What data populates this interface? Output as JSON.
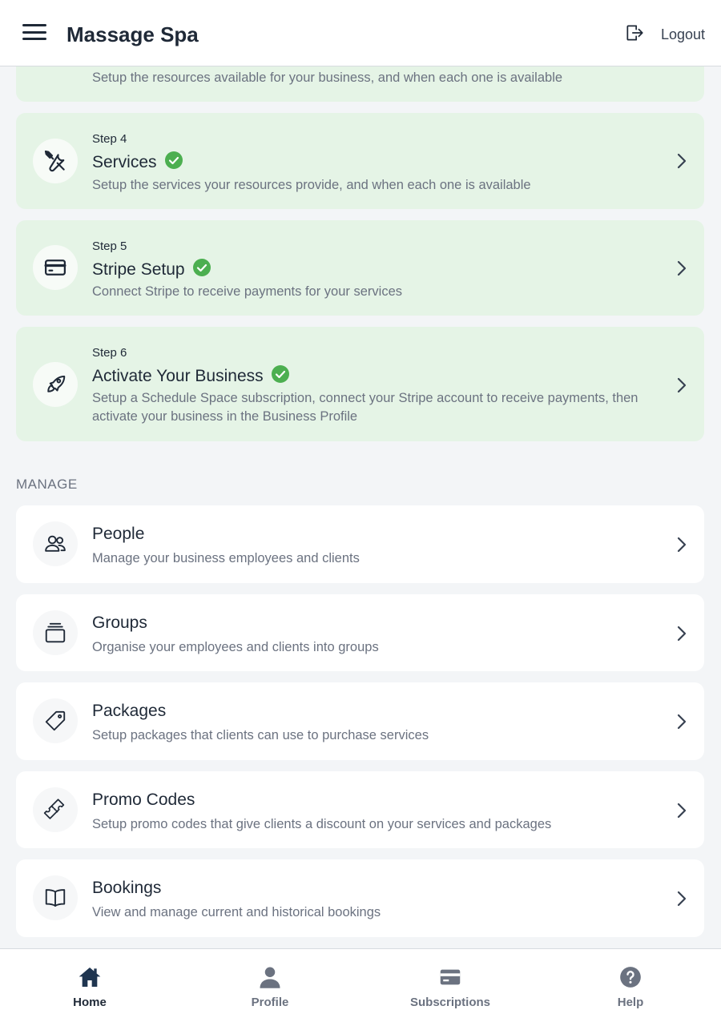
{
  "header": {
    "title": "Massage Spa",
    "logout_label": "Logout"
  },
  "steps": [
    {
      "step": "",
      "title": "",
      "desc": "Setup the resources available for your business, and when each one is available",
      "icon": "resources-icon"
    },
    {
      "step": "Step 4",
      "title": "Services",
      "desc": "Setup the services your resources provide, and when each one is available",
      "icon": "tools-icon",
      "complete": true
    },
    {
      "step": "Step 5",
      "title": "Stripe Setup",
      "desc": "Connect Stripe to receive payments for your services",
      "icon": "credit-card-icon",
      "complete": true
    },
    {
      "step": "Step 6",
      "title": "Activate Your Business",
      "desc": "Setup a Schedule Space subscription, connect your Stripe account to receive payments, then activate your business in the Business Profile",
      "icon": "rocket-icon",
      "complete": true
    }
  ],
  "manage": {
    "section_label": "MANAGE",
    "items": [
      {
        "title": "People",
        "desc": "Manage your business employees and clients",
        "icon": "people-icon"
      },
      {
        "title": "Groups",
        "desc": "Organise your employees and clients into groups",
        "icon": "groups-icon"
      },
      {
        "title": "Packages",
        "desc": "Setup packages that clients can use to purchase services",
        "icon": "tag-icon"
      },
      {
        "title": "Promo Codes",
        "desc": "Setup promo codes that give clients a discount on your services and packages",
        "icon": "ticket-icon"
      },
      {
        "title": "Bookings",
        "desc": "View and manage current and historical bookings",
        "icon": "book-icon"
      }
    ]
  },
  "bottom_nav": [
    {
      "label": "Home",
      "icon": "home-icon",
      "active": true
    },
    {
      "label": "Profile",
      "icon": "user-icon"
    },
    {
      "label": "Subscriptions",
      "icon": "card-icon"
    },
    {
      "label": "Help",
      "icon": "help-icon"
    }
  ],
  "colors": {
    "complete_bg": "#e5f4e6",
    "check_green": "#4caf50",
    "page_bg": "#f3f5f7"
  }
}
